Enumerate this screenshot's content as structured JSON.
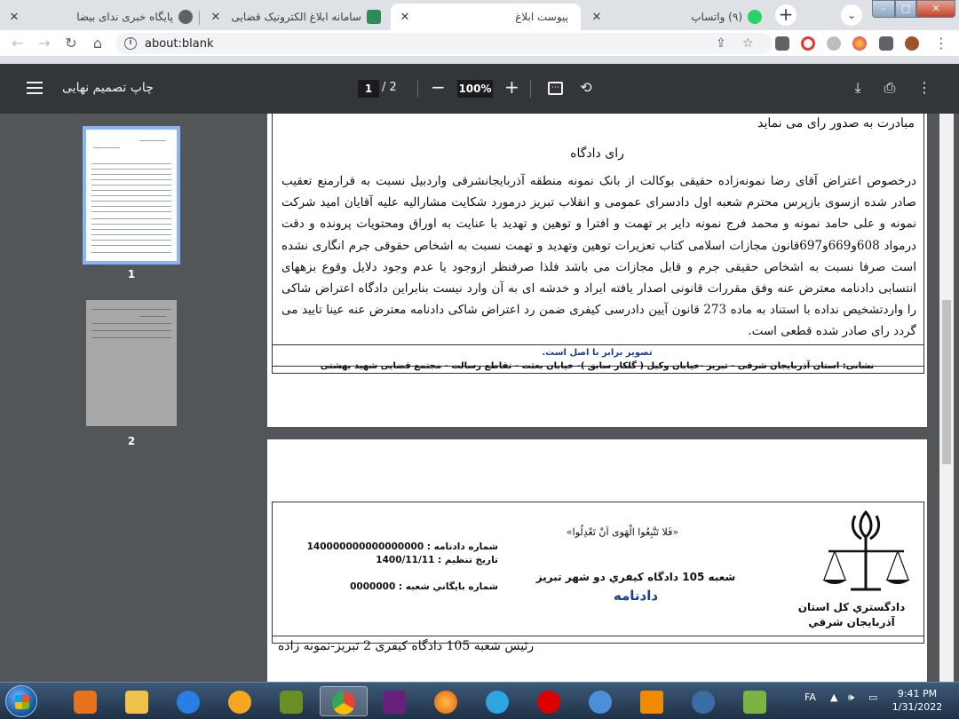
{
  "tabs": [
    {
      "title": "پایگاه خبری ندای بیضا",
      "active": false
    },
    {
      "title": "سامانه ابلاغ الکترونیک قضایی",
      "active": false
    },
    {
      "title": "پیوست ابلاغ",
      "active": true
    },
    {
      "title": "(۹) واتساپ",
      "active": false
    }
  ],
  "address": {
    "url": "about:blank"
  },
  "pdf": {
    "title": "چاپ تصمیم نهایی",
    "page_current": "1",
    "page_total": "/ 2",
    "zoom": "100%"
  },
  "thumbnails": [
    {
      "number": "1"
    },
    {
      "number": "2"
    }
  ],
  "page1": {
    "top_line": "مبادرت به صدور رای می نماید",
    "heading": "رای دادگاه",
    "body": "درخصوص اعتراض آقای رضا نمونه‌زاده حقیقی بوکالت از بانک نمونه منطقه آذربایجانشرقی واردبیل نسبت به قرارمنع تعقیب صادر شده ازسوی بازپرس محترم شعبه اول دادسرای عمومی و انقلاب تبریز درمورد شکایت مشارالیه علیه آقایان امید شرکت نمونه و علی حامد نمونه و محمد فرج نمونه دایر بر تهمت و افترا و توهین و تهدید با عنایت به اوراق ومحتویات پرونده و دقت درمواد 608و669و697قانون مجازات اسلامی کتاب تعزیرات توهین وتهدید و تهمت نسبت به اشخاص حقوقی جرم انگاری نشده است صرفا نسبت به اشخاص حقیقی جرم و قابل مجازات می باشد فلذا صرفنظر ازوجود یا عدم وجود دلایل وقوع بزههای انتسابی دادنامه معترض عنه وفق مقررات قانونی اصدار یافته ایراد و خدشه ای به آن وارد نیست بنابراین دادگاه اعتراض شاکی را واردتشخیص نداده با استناد به ماده 273 قانون آیین دادرسی کیفری ضمن رد اعتراض شاکی دادنامه معترض عنه عینا تایید می گردد رای صادر شده قطعی است.",
    "certified": "تصویر برابر با اصل است.",
    "address_line": "نشانی: استان آذربایجان شرقی - تبریز -خیابان وکیل ( گلکار سابق )- خیابان بعثت - تقاطع رسالت - مجتمع قضایی شهید بهشتی"
  },
  "page2": {
    "verse": "«فَلا تَتَّبِعُوا الْهَوی اَنْ تَعْدِلُوا»",
    "branch": "شعبه 105 دادگاه کیفري دو شهر تبریز",
    "doc_type": "دادنامه",
    "org": "دادگستري کل استان آذربایجان شرقي",
    "ruling_no": "شماره دادنامه : 140000000000000000",
    "date": "تاریخ تنظیم : 1400/11/11",
    "archive_no": "شماره بایگاني شعبه : 0000000",
    "judge_line": "رئیس شعبه 105 دادگاه کیفری 2 تبریز-نمونه زاده"
  },
  "taskbar": {
    "lang": "FA",
    "time": "9:41 PM",
    "date": "1/31/2022"
  },
  "colors": {
    "pdf_toolbar": "#323639",
    "viewer_bg": "#525659",
    "thumb_selected": "#8ab4f8",
    "footer_blue": "#1a3d8a"
  }
}
